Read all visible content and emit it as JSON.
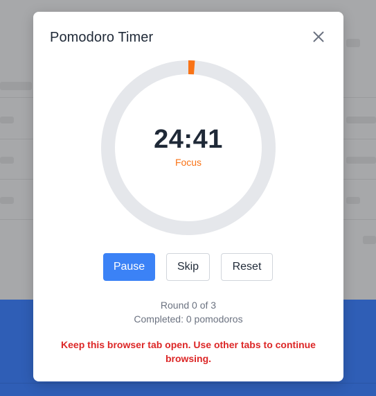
{
  "modal": {
    "title": "Pomodoro Timer",
    "close_icon": "close-icon"
  },
  "timer": {
    "time": "24:41",
    "phase": "Focus",
    "progress_fraction": 0.012,
    "track_color": "#e5e7eb",
    "progress_color": "#f97316"
  },
  "controls": {
    "pause_label": "Pause",
    "skip_label": "Skip",
    "reset_label": "Reset",
    "accent": "#3b82f6"
  },
  "status": {
    "round": "Round 0 of 3",
    "completed": "Completed: 0 pomodoros"
  },
  "warning": {
    "text": "Keep this browser tab open. Use other tabs to continue browsing.",
    "color": "#dc2626"
  }
}
